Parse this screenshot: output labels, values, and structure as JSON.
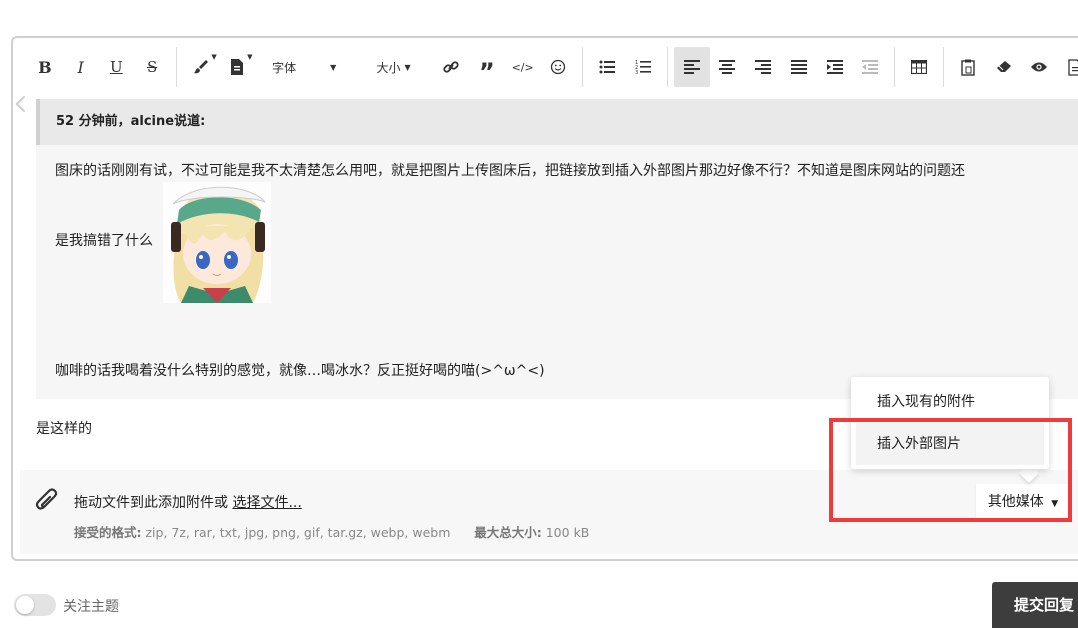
{
  "toolbar": {
    "font_label": "字体",
    "size_label": "大小"
  },
  "quote": {
    "header": "52 分钟前，alcine说道:",
    "line1": "图床的话刚刚有试，不过可能是我不太清楚怎么用吧，就是把图片上传图床后，把链接放到插入外部图片那边好像不行？不知道是图床网站的问题还",
    "line2": "是我搞错了什么",
    "line3": "咖啡的话我喝着没什么特别的感觉，就像…喝冰水？反正挺好喝的喵(>^ω^<)"
  },
  "reply_text": "是这样的",
  "attachments": {
    "drop_text": "拖动文件到此添加附件或 ",
    "choose_link": "选择文件...",
    "accepted_label": "接受的格式:",
    "accepted_formats": "zip, 7z, rar, txt, jpg, png, gif, tar.gz, webp, webm",
    "max_size_label": "最大总大小:",
    "max_size": "100 kB",
    "media_button": "其他媒体"
  },
  "menu": {
    "items": [
      {
        "label": "插入现有的附件"
      },
      {
        "label": "插入外部图片"
      }
    ]
  },
  "follow_toggle_label": "关注主题",
  "submit_label": "提交回复",
  "colors": {
    "highlight": "#ef3b3b",
    "submit_bg": "#3d3d3d",
    "active_tool": "#e2e2e2"
  }
}
